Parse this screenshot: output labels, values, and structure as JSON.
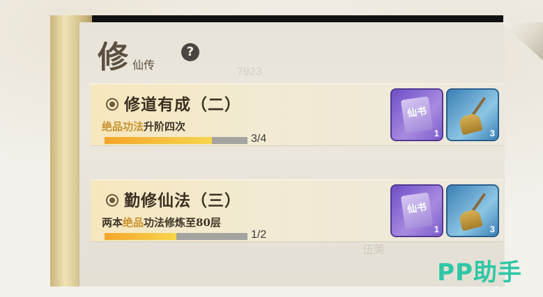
{
  "header": {
    "title_char": "修",
    "subtitle": "仙传",
    "help_symbol": "?"
  },
  "watermarks": [
    "7923",
    "伍美"
  ],
  "quests": [
    {
      "title": "修道有成（二）",
      "desc_prefix": "",
      "desc_highlight": "绝品功法",
      "desc_suffix": "升阶四次",
      "progress_text": "3/4",
      "progress_fraction": 0.75,
      "rewards": [
        {
          "type": "skill-book",
          "glyph": "仙书",
          "count": "1",
          "color": "#6d4fc7"
        },
        {
          "type": "broom",
          "count": "3",
          "color": "#3a7fb4"
        }
      ]
    },
    {
      "title": "勤修仙法（三）",
      "desc_prefix": "两本",
      "desc_highlight": "绝品",
      "desc_suffix": "功法修炼至80层",
      "progress_text": "1/2",
      "progress_fraction": 0.5,
      "rewards": [
        {
          "type": "skill-book",
          "glyph": "仙书",
          "count": "1",
          "color": "#6d4fc7"
        },
        {
          "type": "broom",
          "count": "3",
          "color": "#3a7fb4"
        }
      ]
    }
  ],
  "corner_watermark": "PP助手",
  "colors": {
    "highlight": "#c7912c",
    "progress_fill": "#f3a52b",
    "watermark": "#2ec7a6"
  }
}
